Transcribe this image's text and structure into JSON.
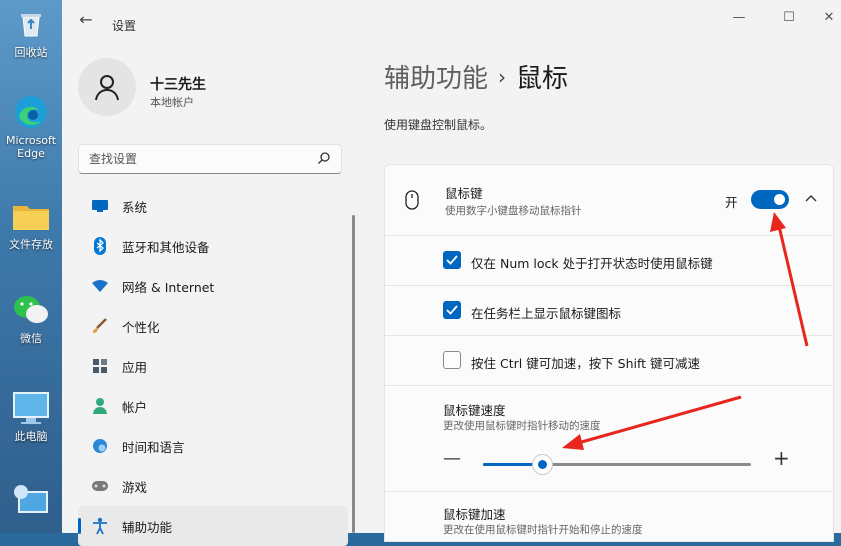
{
  "desktop": {
    "icons": [
      {
        "label": "回收站",
        "icon": "recycle-bin-icon"
      },
      {
        "label": "Microsoft Edge",
        "icon": "edge-icon"
      },
      {
        "label": "文件存放",
        "icon": "folder-icon"
      },
      {
        "label": "微信",
        "icon": "wechat-icon"
      },
      {
        "label": "此电脑",
        "icon": "computer-icon"
      },
      {
        "label": "",
        "icon": "network-icon"
      }
    ]
  },
  "window": {
    "title": "设置",
    "minimize": "—",
    "maximize": "☐",
    "close": "✕"
  },
  "user": {
    "name": "十三先生",
    "account_type": "本地帐户"
  },
  "search": {
    "placeholder": "查找设置"
  },
  "nav": {
    "items": [
      {
        "label": "系统",
        "icon": "system-icon",
        "color": "#0067c0"
      },
      {
        "label": "蓝牙和其他设备",
        "icon": "bluetooth-icon",
        "color": "#0078d4"
      },
      {
        "label": "网络 & Internet",
        "icon": "wifi-icon",
        "color": "#1a73c9"
      },
      {
        "label": "个性化",
        "icon": "brush-icon",
        "color": "#c9772a"
      },
      {
        "label": "应用",
        "icon": "apps-icon",
        "color": "#4a5a6a"
      },
      {
        "label": "帐户",
        "icon": "account-icon",
        "color": "#2fa87a"
      },
      {
        "label": "时间和语言",
        "icon": "globe-icon",
        "color": "#2b88d8"
      },
      {
        "label": "游戏",
        "icon": "gamepad-icon",
        "color": "#6b6b6b"
      },
      {
        "label": "辅助功能",
        "icon": "accessibility-icon",
        "color": "#1a73c9"
      }
    ],
    "selected": "辅助功能"
  },
  "breadcrumb": {
    "parent": "辅助功能",
    "separator": "›",
    "current": "鼠标"
  },
  "page_description": "使用键盘控制鼠标。",
  "mouse_keys": {
    "title": "鼠标键",
    "description": "使用数字小键盘移动鼠标指针",
    "state_label": "开",
    "enabled": true,
    "expanded": true
  },
  "options": [
    {
      "label": "仅在 Num lock 处于打开状态时使用鼠标键",
      "checked": true
    },
    {
      "label": "在任务栏上显示鼠标键图标",
      "checked": true
    },
    {
      "label": "按住 Ctrl 键可加速，按下 Shift 键可减速",
      "checked": false
    }
  ],
  "speed": {
    "title": "鼠标键速度",
    "description": "更改使用鼠标键时指针移动的速度",
    "minus": "—",
    "plus": "+",
    "value_fraction": 0.22
  },
  "acceleration": {
    "title": "鼠标键加速",
    "description": "更改在使用鼠标键时指针开始和停止的速度"
  },
  "colors": {
    "accent": "#0067c0",
    "annotation_arrow": "#e8261d"
  }
}
